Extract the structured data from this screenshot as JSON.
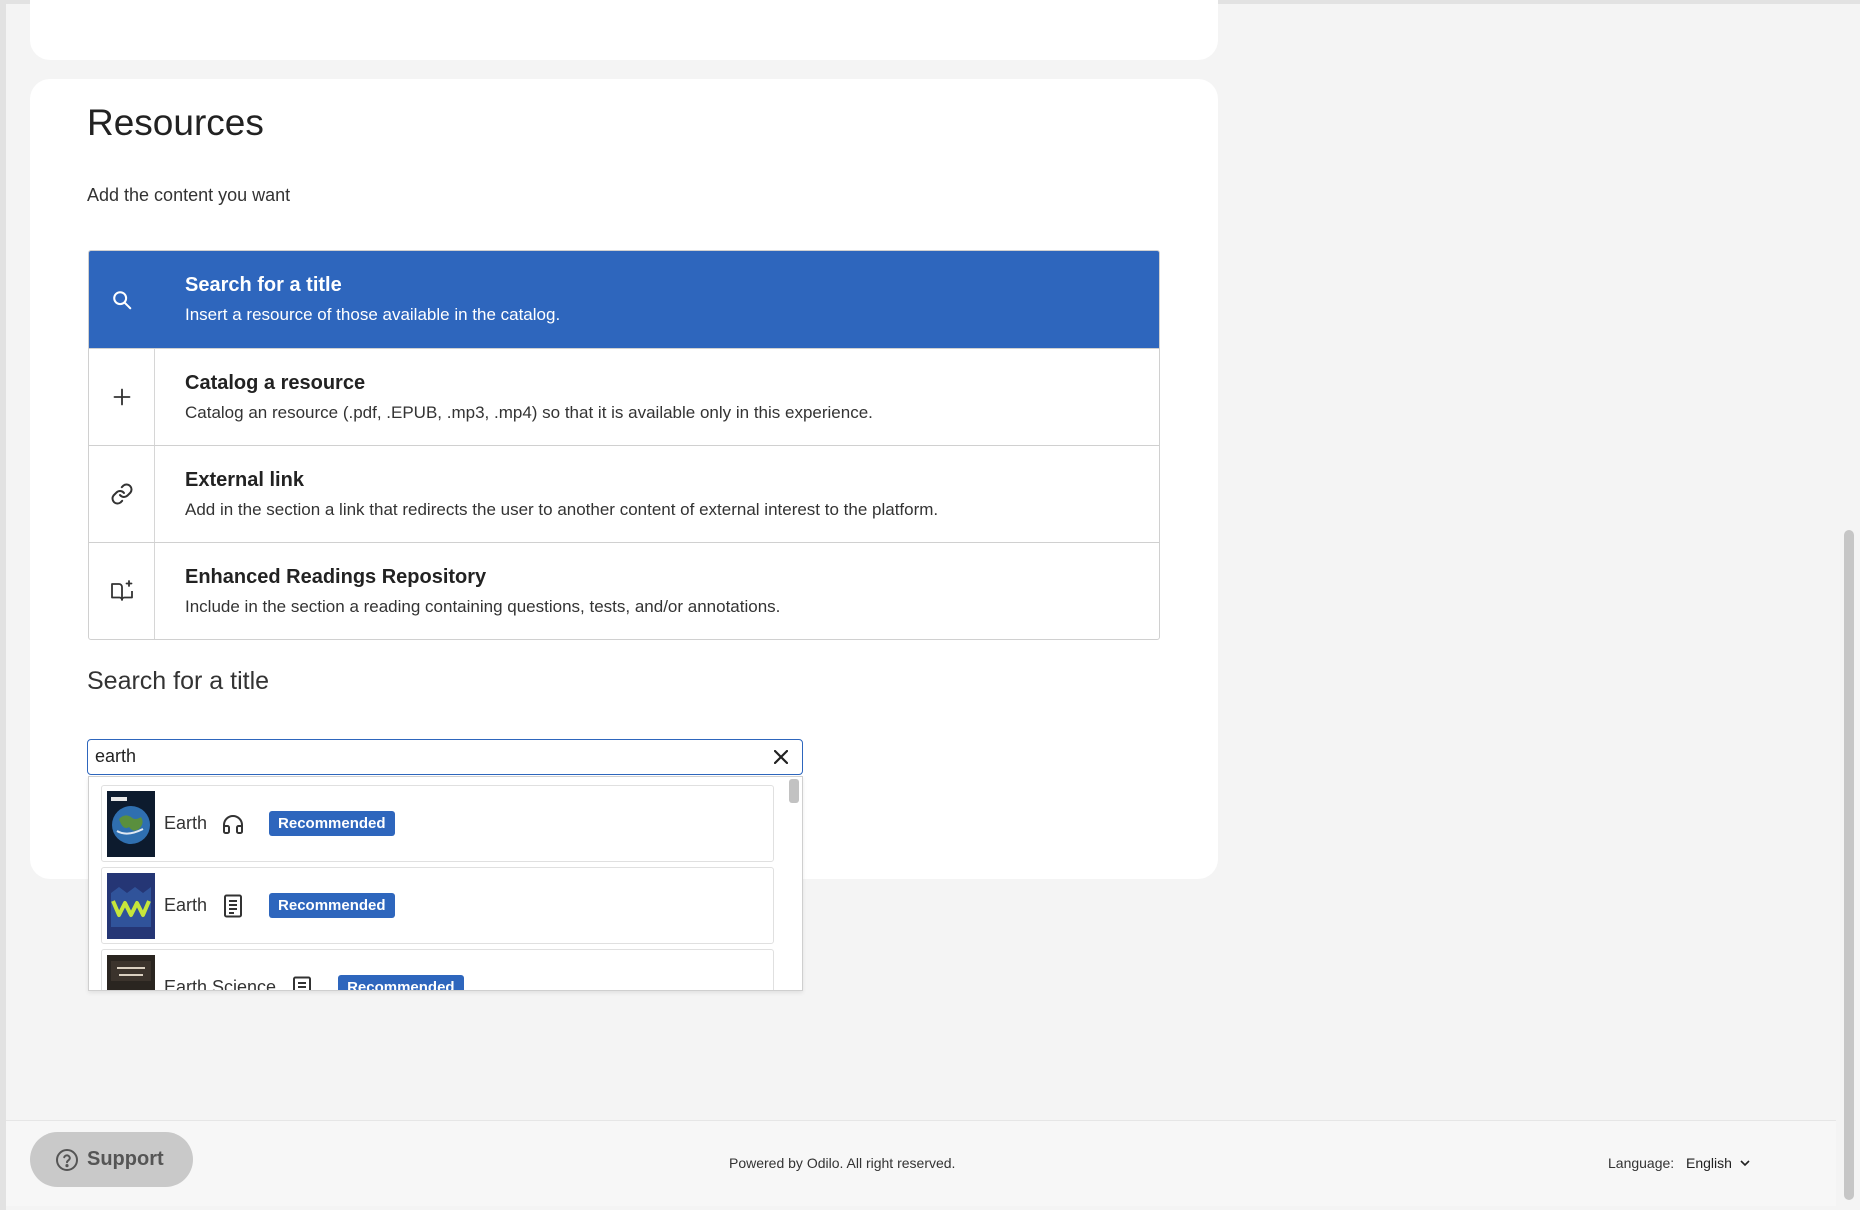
{
  "resources": {
    "title": "Resources",
    "subtitle": "Add the content you want"
  },
  "options": [
    {
      "title": "Search for a title",
      "desc": "Insert a resource of those available in the catalog.",
      "icon": "search-icon",
      "active": true
    },
    {
      "title": "Catalog a resource",
      "desc": "Catalog an resource (.pdf, .EPUB, .mp3, .mp4) so that it is available only in this experience.",
      "icon": "plus-icon"
    },
    {
      "title": "External link",
      "desc": "Add in the section a link that redirects the user to another content of external interest to the platform.",
      "icon": "link-icon"
    },
    {
      "title": "Enhanced Readings Repository",
      "desc": "Include in the section a reading containing questions, tests, and/or annotations.",
      "icon": "book-sparkle-icon"
    }
  ],
  "search": {
    "heading": "Search for a title",
    "value": "earth"
  },
  "results": [
    {
      "title": "Earth",
      "format_icon": "headphones-icon",
      "badge": "Recommended"
    },
    {
      "title": "Earth",
      "format_icon": "document-icon",
      "badge": "Recommended"
    },
    {
      "title": "Earth Science",
      "format_icon": "document-icon",
      "badge": "Recommended"
    }
  ],
  "footer": {
    "support": "Support",
    "powered": "Powered by Odilo. All right reserved.",
    "language_label": "Language:",
    "language_value": "English"
  },
  "colors": {
    "accent": "#2e66bd",
    "background": "#f4f4f4"
  }
}
